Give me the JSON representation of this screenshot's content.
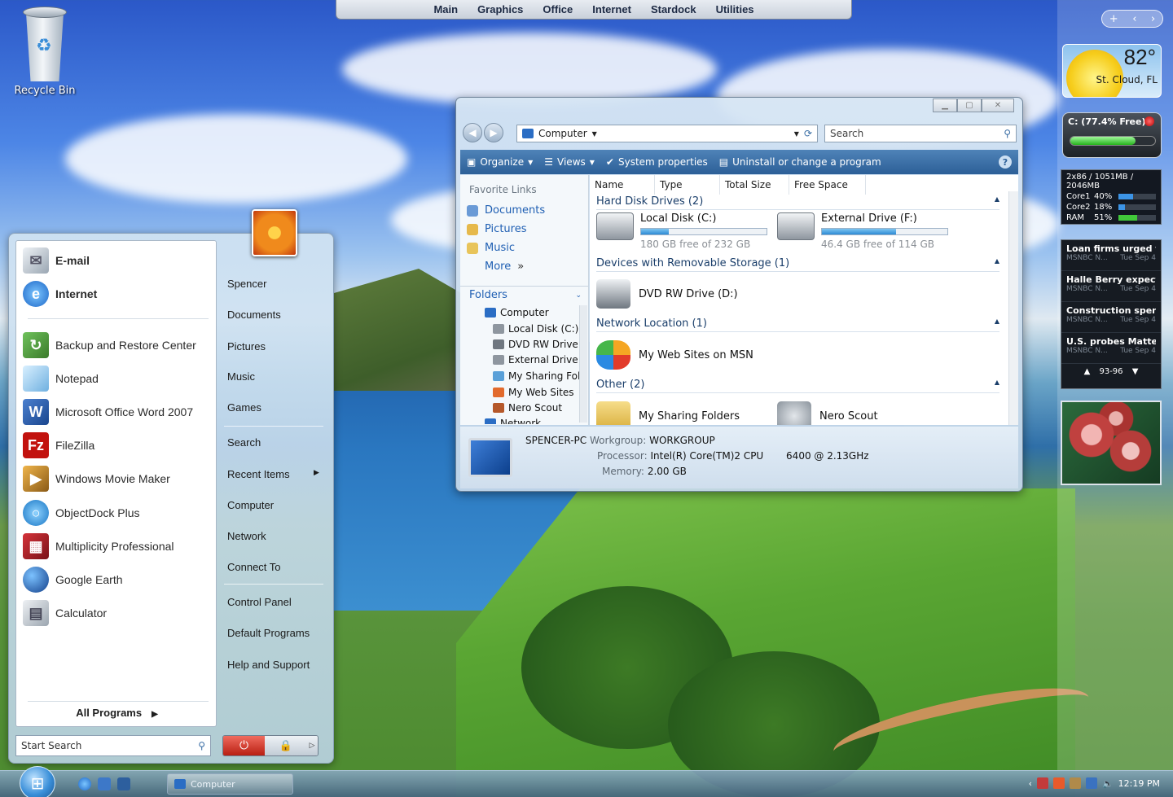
{
  "top_dock": {
    "items": [
      "Main",
      "Graphics",
      "Office",
      "Internet",
      "Stardock",
      "Utilities"
    ]
  },
  "desktop": {
    "recycle_bin_label": "Recycle Bin"
  },
  "start_menu": {
    "pinned": [
      {
        "label": "E-mail",
        "icon": "email-icon"
      },
      {
        "label": "Internet",
        "icon": "ie-icon"
      }
    ],
    "recent": [
      {
        "label": "Backup and Restore Center",
        "icon": "backup-icon"
      },
      {
        "label": "Notepad",
        "icon": "notepad-icon"
      },
      {
        "label": "Microsoft Office Word 2007",
        "icon": "word-icon"
      },
      {
        "label": "FileZilla",
        "icon": "filezilla-icon"
      },
      {
        "label": "Windows Movie Maker",
        "icon": "movie-maker-icon"
      },
      {
        "label": "ObjectDock Plus",
        "icon": "objectdock-icon"
      },
      {
        "label": "Multiplicity Professional",
        "icon": "multiplicity-icon"
      },
      {
        "label": "Google Earth",
        "icon": "google-earth-icon"
      },
      {
        "label": "Calculator",
        "icon": "calculator-icon"
      }
    ],
    "all_programs": "All Programs",
    "search_placeholder": "Start Search",
    "right": [
      "Spencer",
      "Documents",
      "Pictures",
      "Music",
      "Games",
      "Search",
      "Recent Items",
      "Computer",
      "Network",
      "Connect To",
      "Control Panel",
      "Default Programs",
      "Help and Support"
    ]
  },
  "explorer": {
    "address": "Computer",
    "search_placeholder": "Search",
    "commands": [
      "Organize",
      "Views",
      "System properties",
      "Uninstall or change a program"
    ],
    "favorite_links_title": "Favorite Links",
    "favorites": [
      "Documents",
      "Pictures",
      "Music",
      "More"
    ],
    "folders_label": "Folders",
    "tree": [
      "Computer",
      "Local Disk (C:)",
      "DVD RW Drive",
      "External Drive",
      "My Sharing Fol",
      "My Web Sites",
      "Nero Scout",
      "Network"
    ],
    "columns": [
      "Name",
      "Type",
      "Total Size",
      "Free Space"
    ],
    "groups": {
      "hdd": "Hard Disk Drives (2)",
      "removable": "Devices with Removable Storage (1)",
      "network": "Network Location (1)",
      "other": "Other (2)"
    },
    "drives": [
      {
        "name": "Local Disk (C:)",
        "free": "180 GB free of 232 GB",
        "used_fraction": 0.22
      },
      {
        "name": "External Drive (F:)",
        "free": "46.4 GB free of 114 GB",
        "used_fraction": 0.59
      }
    ],
    "removable": "DVD RW Drive (D:)",
    "network_item": "My Web Sites on MSN",
    "other_items": [
      "My Sharing Folders",
      "Nero Scout"
    ],
    "details": {
      "pc_name": "SPENCER-PC",
      "workgroup_label": "Workgroup:",
      "workgroup": "WORKGROUP",
      "processor_label": "Processor:",
      "processor": "Intel(R) Core(TM)2 CPU",
      "processor_model": "6400  @ 2.13GHz",
      "memory_label": "Memory:",
      "memory": "2.00 GB"
    }
  },
  "gadgets": {
    "weather": {
      "temp": "82°",
      "city": "St. Cloud, FL"
    },
    "drive": {
      "label": "C: (77.4% Free)",
      "free_fraction": 0.774
    },
    "cpu": {
      "header": "2x86 / 1051MB / 2046MB",
      "rows": [
        {
          "name": "Core1",
          "pct": "40%",
          "value": 0.4
        },
        {
          "name": "Core2",
          "pct": "18%",
          "value": 0.18
        },
        {
          "name": "RAM",
          "pct": "51%",
          "value": 0.51
        }
      ]
    },
    "news": [
      {
        "headline": "Loan firms urged to ...",
        "source": "MSNBC N...",
        "date": "Tue Sep 4"
      },
      {
        "headline": "Halle Berry expectin...",
        "source": "MSNBC N...",
        "date": "Tue Sep 4"
      },
      {
        "headline": "Construction spendin...",
        "source": "MSNBC N...",
        "date": "Tue Sep 4"
      },
      {
        "headline": "U.S. probes Mattel di...",
        "source": "MSNBC N...",
        "date": "Tue Sep 4"
      }
    ],
    "news_pager": "93-96"
  },
  "taskbar": {
    "task": "Computer",
    "clock": "12:19 PM"
  }
}
